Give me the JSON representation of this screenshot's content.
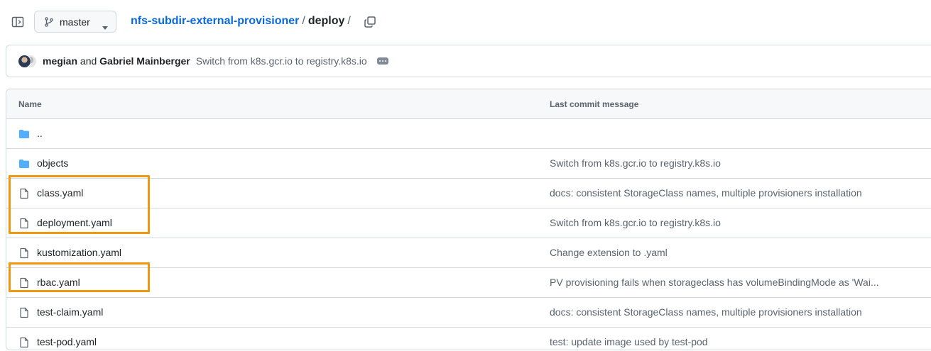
{
  "header": {
    "branch": "master",
    "breadcrumb": {
      "repo": "nfs-subdir-external-provisioner",
      "separator": "/",
      "folder": "deploy",
      "trailing_separator": "/"
    }
  },
  "latest_commit": {
    "author_1": "megian",
    "conjunction": "and",
    "author_2": "Gabriel Mainberger",
    "message": "Switch from k8s.gcr.io to registry.k8s.io"
  },
  "table": {
    "columns": {
      "name": "Name",
      "last_commit": "Last commit message"
    },
    "rows": [
      {
        "name": "..",
        "type": "folder",
        "message": ""
      },
      {
        "name": "objects",
        "type": "folder",
        "message": "Switch from k8s.gcr.io to registry.k8s.io"
      },
      {
        "name": "class.yaml",
        "type": "file",
        "message": "docs: consistent StorageClass names, multiple provisioners installation"
      },
      {
        "name": "deployment.yaml",
        "type": "file",
        "message": "Switch from k8s.gcr.io to registry.k8s.io"
      },
      {
        "name": "kustomization.yaml",
        "type": "file",
        "message": "Change extension to .yaml"
      },
      {
        "name": "rbac.yaml",
        "type": "file",
        "message": "PV provisioning fails when storageclass has volumeBindingMode as 'Wai..."
      },
      {
        "name": "test-claim.yaml",
        "type": "file",
        "message": "docs: consistent StorageClass names, multiple provisioners installation"
      },
      {
        "name": "test-pod.yaml",
        "type": "file",
        "message": "test: update image used by test-pod"
      }
    ]
  },
  "icons": {
    "sidebar_toggle": "sidebar-toggle-icon",
    "branch": "git-branch-icon",
    "caret": "triangle-down-icon",
    "copy": "copy-icon",
    "folder": "folder-icon",
    "file": "file-icon",
    "ellipsis": "ellipsis-icon"
  },
  "colors": {
    "link": "#0969da",
    "folder": "#54aeff",
    "highlight": "#f0960f",
    "border": "#d1d9e0",
    "muted_text": "#59636e"
  }
}
